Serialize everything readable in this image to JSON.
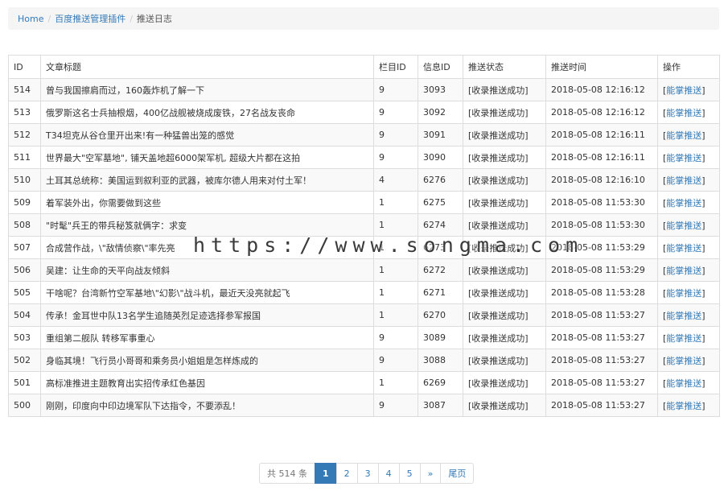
{
  "breadcrumb": {
    "home": "Home",
    "plugin": "百度推送管理插件",
    "current": "推送日志"
  },
  "table": {
    "headers": [
      "ID",
      "文章标题",
      "栏目ID",
      "信息ID",
      "推送状态",
      "推送时间",
      "操作"
    ],
    "action_label": "能掌推送",
    "rows": [
      {
        "id": "514",
        "title": "曾与我国擦肩而过，160轰炸机了解一下",
        "cat": "9",
        "info": "3093",
        "status": "[收录推送成功]",
        "time": "2018-05-08 12:16:12"
      },
      {
        "id": "513",
        "title": "俄罗斯这名士兵抽根烟，400亿战舰被烧成废铁，27名战友丧命",
        "cat": "9",
        "info": "3092",
        "status": "[收录推送成功]",
        "time": "2018-05-08 12:16:12"
      },
      {
        "id": "512",
        "title": "T34坦克从谷仓里开出来!有一种猛兽出笼的感觉",
        "cat": "9",
        "info": "3091",
        "status": "[收录推送成功]",
        "time": "2018-05-08 12:16:11"
      },
      {
        "id": "511",
        "title": "世界最大\"空军墓地\", 铺天盖地超6000架军机, 超级大片都在这拍",
        "cat": "9",
        "info": "3090",
        "status": "[收录推送成功]",
        "time": "2018-05-08 12:16:11"
      },
      {
        "id": "510",
        "title": "土耳其总统称：美国运到叙利亚的武器，被库尔德人用来对付土军！",
        "cat": "4",
        "info": "6276",
        "status": "[收录推送成功]",
        "time": "2018-05-08 12:16:10"
      },
      {
        "id": "509",
        "title": "着军装外出，你需要做到这些",
        "cat": "1",
        "info": "6275",
        "status": "[收录推送成功]",
        "time": "2018-05-08 11:53:30"
      },
      {
        "id": "508",
        "title": "\"时髦\"兵王的带兵秘笈就俩字：求变",
        "cat": "1",
        "info": "6274",
        "status": "[收录推送成功]",
        "time": "2018-05-08 11:53:30"
      },
      {
        "id": "507",
        "title": "合成营作战，\\\"敌情侦察\\\"率先亮",
        "cat": "1",
        "info": "6273",
        "status": "[收录推送成功]",
        "time": "2018-05-08 11:53:29"
      },
      {
        "id": "506",
        "title": "吴建：让生命的天平向战友倾斜",
        "cat": "1",
        "info": "6272",
        "status": "[收录推送成功]",
        "time": "2018-05-08 11:53:29"
      },
      {
        "id": "505",
        "title": "干啥呢？台湾新竹空军基地\\\"幻影\\\"战斗机，最近天没亮就起飞",
        "cat": "1",
        "info": "6271",
        "status": "[收录推送成功]",
        "time": "2018-05-08 11:53:28"
      },
      {
        "id": "504",
        "title": "传承！金耳世中队13名学生追随英烈足迹选择参军报国",
        "cat": "1",
        "info": "6270",
        "status": "[收录推送成功]",
        "time": "2018-05-08 11:53:27"
      },
      {
        "id": "503",
        "title": "重组第二舰队 转移军事重心",
        "cat": "9",
        "info": "3089",
        "status": "[收录推送成功]",
        "time": "2018-05-08 11:53:27"
      },
      {
        "id": "502",
        "title": "身临其境！飞行员小哥哥和乘务员小姐姐是怎样炼成的",
        "cat": "9",
        "info": "3088",
        "status": "[收录推送成功]",
        "time": "2018-05-08 11:53:27"
      },
      {
        "id": "501",
        "title": "高标准推进主题教育出实招传承红色基因",
        "cat": "1",
        "info": "6269",
        "status": "[收录推送成功]",
        "time": "2018-05-08 11:53:27"
      },
      {
        "id": "500",
        "title": "刚刚，印度向中印边境军队下达指令，不要添乱！",
        "cat": "9",
        "info": "3087",
        "status": "[收录推送成功]",
        "time": "2018-05-08 11:53:27"
      }
    ]
  },
  "pagination": {
    "total": "共 514 条",
    "pages": [
      "1",
      "2",
      "3",
      "4",
      "5"
    ],
    "current": "1",
    "next": "»",
    "last": "尾页"
  },
  "watermark": "https://www.songma.com",
  "colors": {
    "link": "#337ab7",
    "active_page": "#337ab7",
    "stripe": "#f9f9f9",
    "border": "#dddddd"
  }
}
